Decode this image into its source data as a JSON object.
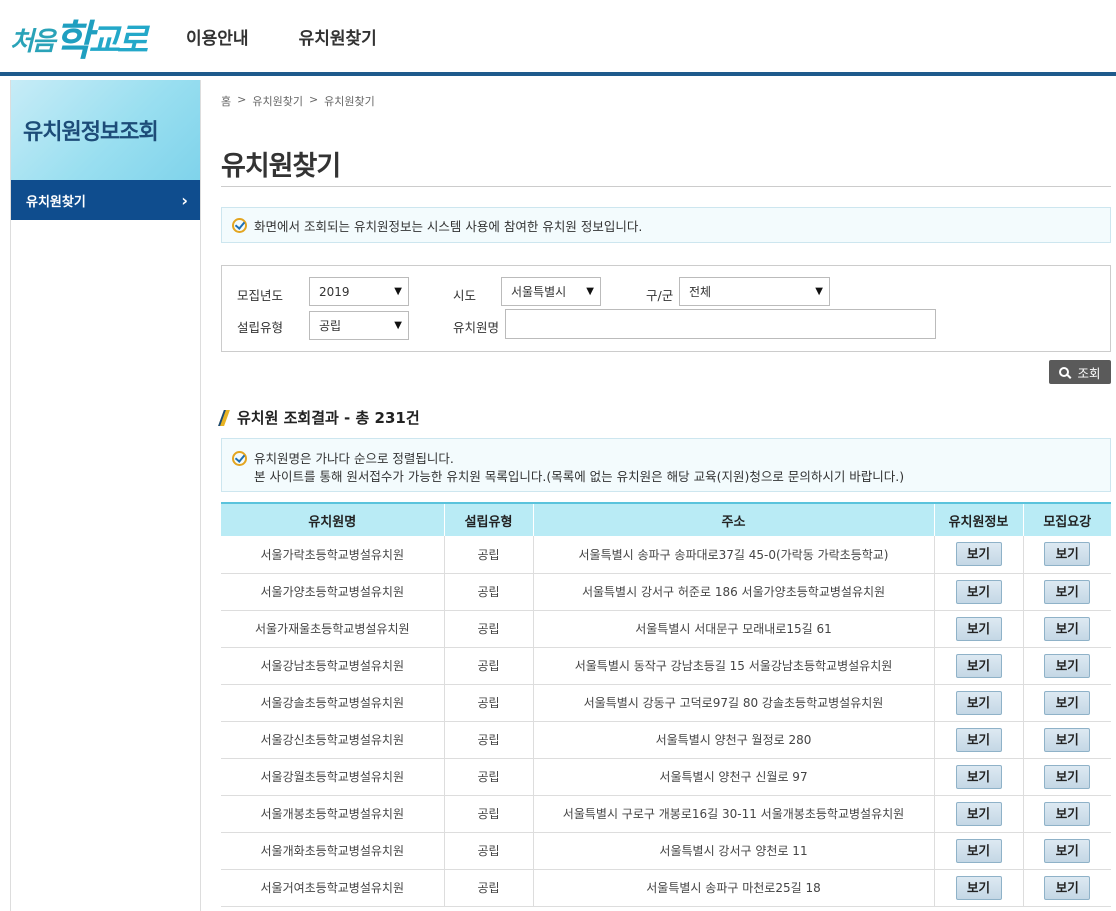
{
  "header": {
    "logo_text": "처음학교로",
    "logo_parts": [
      "처음",
      "학",
      "교로"
    ],
    "nav": [
      "이용안내",
      "유치원찾기"
    ]
  },
  "sidebar": {
    "title": "유치원정보조회",
    "items": [
      {
        "label": "유치원찾기",
        "icon": "chevron-right-icon"
      }
    ]
  },
  "breadcrumb": [
    "홈",
    ">",
    "유치원찾기",
    ">",
    "유치원찾기"
  ],
  "page_title": "유치원찾기",
  "notice_top": "화면에서 조회되는 유치원정보는 시스템 사용에 참여한 유치원 정보입니다.",
  "search": {
    "year_label": "모집년도",
    "year_value": "2019",
    "sido_label": "시도",
    "sido_value": "서울특별시",
    "gugun_label": "구/군",
    "gugun_value": "전체",
    "type_label": "설립유형",
    "type_value": "공립",
    "name_label": "유치원명",
    "name_value": "",
    "button_label": "조회"
  },
  "result": {
    "title": "유치원 조회결과 - 총 231건",
    "notice_lines": [
      "유치원명은 가나다 순으로 정렬됩니다.",
      "본 사이트를 통해 원서접수가 가능한 유치원 목록입니다.(목록에 없는 유치원은 해당 교육(지원)청으로 문의하시기 바랍니다.)"
    ]
  },
  "table": {
    "columns": [
      "유치원명",
      "설립유형",
      "주소",
      "유치원정보",
      "모집요강"
    ],
    "button_label": "보기",
    "rows": [
      [
        "서울가락초등학교병설유치원",
        "공립",
        "서울특별시 송파구 송파대로37길 45-0(가락동 가락초등학교)"
      ],
      [
        "서울가양초등학교병설유치원",
        "공립",
        "서울특별시 강서구 허준로 186 서울가양초등학교병설유치원"
      ],
      [
        "서울가재울초등학교병설유치원",
        "공립",
        "서울특별시 서대문구 모래내로15길 61"
      ],
      [
        "서울강남초등학교병설유치원",
        "공립",
        "서울특별시 동작구 강남초등길 15 서울강남초등학교병설유치원"
      ],
      [
        "서울강솔초등학교병설유치원",
        "공립",
        "서울특별시 강동구 고덕로97길 80 강솔초등학교병설유치원"
      ],
      [
        "서울강신초등학교병설유치원",
        "공립",
        "서울특별시 양천구 월정로 280"
      ],
      [
        "서울강월초등학교병설유치원",
        "공립",
        "서울특별시 양천구 신월로 97"
      ],
      [
        "서울개봉초등학교병설유치원",
        "공립",
        "서울특별시 구로구 개봉로16길 30-11 서울개봉초등학교병설유치원"
      ],
      [
        "서울개화초등학교병설유치원",
        "공립",
        "서울특별시 강서구 양천로 11"
      ],
      [
        "서울거여초등학교병설유치원",
        "공립",
        "서울특별시 송파구 마천로25길 18"
      ]
    ]
  }
}
